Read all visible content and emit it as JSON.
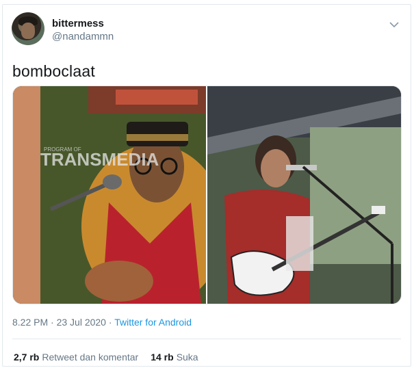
{
  "tweet": {
    "display_name": "bittermess",
    "handle": "@nandammn",
    "text": "bomboclaat",
    "timestamp": "8.22 PM · 23 Jul 2020",
    "separator": " · ",
    "source": "Twitter for Android",
    "menu_icon": "chevron-down-icon"
  },
  "media": {
    "left_watermark": "TRANSMEDIA",
    "left_watermark_top": "PROGRAM OF"
  },
  "stats": {
    "retweets_count": "2,7 rb",
    "retweets_label": "Retweet dan komentar",
    "likes_count": "14 rb",
    "likes_label": "Suka"
  },
  "colors": {
    "text": "#14171a",
    "secondary": "#657786",
    "link": "#1b95e0",
    "border": "#e1e8ed"
  }
}
